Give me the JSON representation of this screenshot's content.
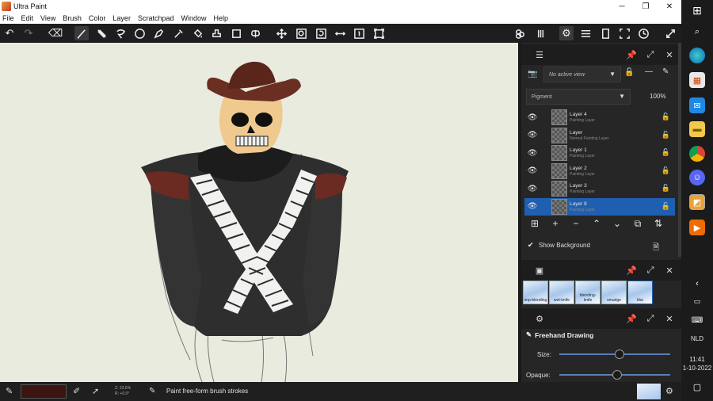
{
  "window": {
    "title": "Ultra Paint"
  },
  "menu": {
    "items": [
      "File",
      "Edit",
      "View",
      "Brush",
      "Color",
      "Layer",
      "Scratchpad",
      "Window",
      "Help"
    ]
  },
  "layers_panel": {
    "view_select": "No active view",
    "blend_mode": "Pigment",
    "opacity": "100%",
    "layers": [
      {
        "name": "Layer 4",
        "type": "Painting Layer",
        "selected": false
      },
      {
        "name": "Layer",
        "type": "Normal Painting Layer",
        "selected": false
      },
      {
        "name": "Layer 1",
        "type": "Painting Layer",
        "selected": false
      },
      {
        "name": "Layer 2",
        "type": "Painting Layer",
        "selected": false
      },
      {
        "name": "Layer 3",
        "type": "Painting Layer",
        "selected": false
      },
      {
        "name": "Layer 8",
        "type": "Painting Layer",
        "selected": true
      }
    ],
    "show_background_label": "Show Background",
    "show_background_checked": true
  },
  "brush_panel": {
    "presets": [
      "imp-blending",
      "wet-knife",
      "blending-knife",
      "smudge",
      "blur"
    ]
  },
  "tool_panel": {
    "title": "Freehand Drawing",
    "size_label": "Size:",
    "opaque_label": "Opaque:",
    "size_value": 0.54,
    "opaque_value": 0.52
  },
  "status": {
    "zoom_line1": "Z: 23.6%",
    "zoom_line2": "R: +0.0°",
    "message": "Paint free-form brush strokes",
    "current_color": "#3c1510"
  },
  "taskbar": {
    "language": "NLD",
    "time": "11:41",
    "date": "1-10-2022"
  },
  "colors": {
    "accent": "#1f5fb0",
    "canvas_bg": "#e9ebdf"
  }
}
